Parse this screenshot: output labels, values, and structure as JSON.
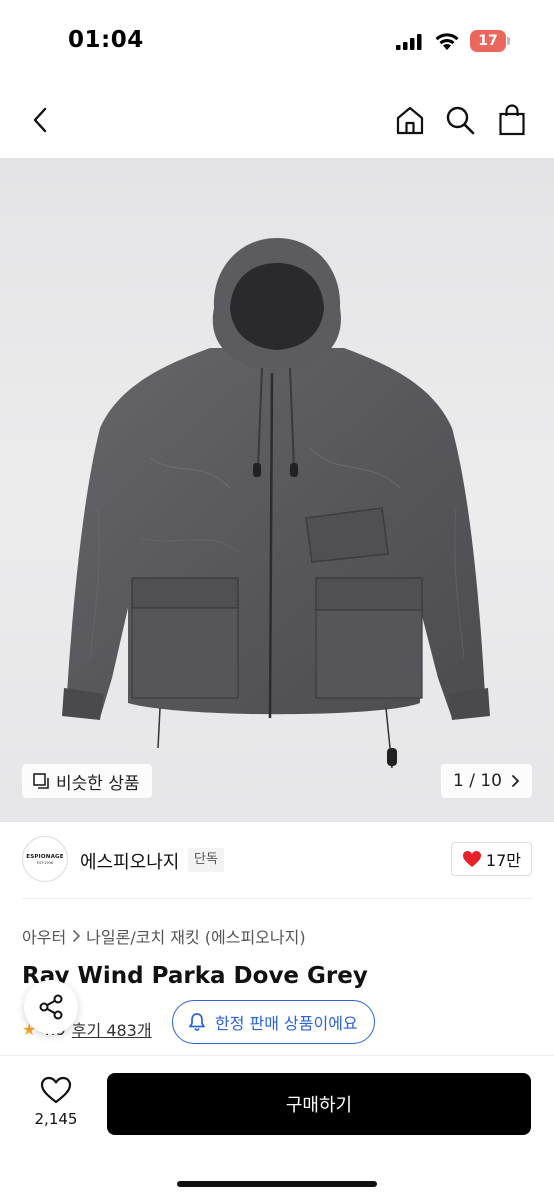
{
  "status_bar": {
    "time": "01:04",
    "battery": "17"
  },
  "nav": {
    "icons": [
      "back-icon",
      "home-icon",
      "search-icon",
      "shopping-bag-icon"
    ]
  },
  "gallery": {
    "similar_label": "비슷한 상품",
    "pager": "1 / 10"
  },
  "brand": {
    "logo_text": "ESPIONAGE",
    "logo_sub": "EST.1996",
    "name": "에스피오나지",
    "badge": "단독",
    "likes": "17만"
  },
  "breadcrumb": {
    "category": "아우터",
    "subcategory": "나일론/코치 재킷 (에스피오나지)"
  },
  "product": {
    "title": "Ray Wind Parka Dove Grey",
    "rating": "4.9",
    "review_label": "후기 483개"
  },
  "limited_notice": "한정 판매 상품이에요",
  "bottom_bar": {
    "wish_count": "2,145",
    "buy_label": "구매하기"
  },
  "colors": {
    "accent_blue": "#2b63d9",
    "heart_red": "#e8202a",
    "buy_button": "#000000",
    "star": "#f5a623"
  }
}
